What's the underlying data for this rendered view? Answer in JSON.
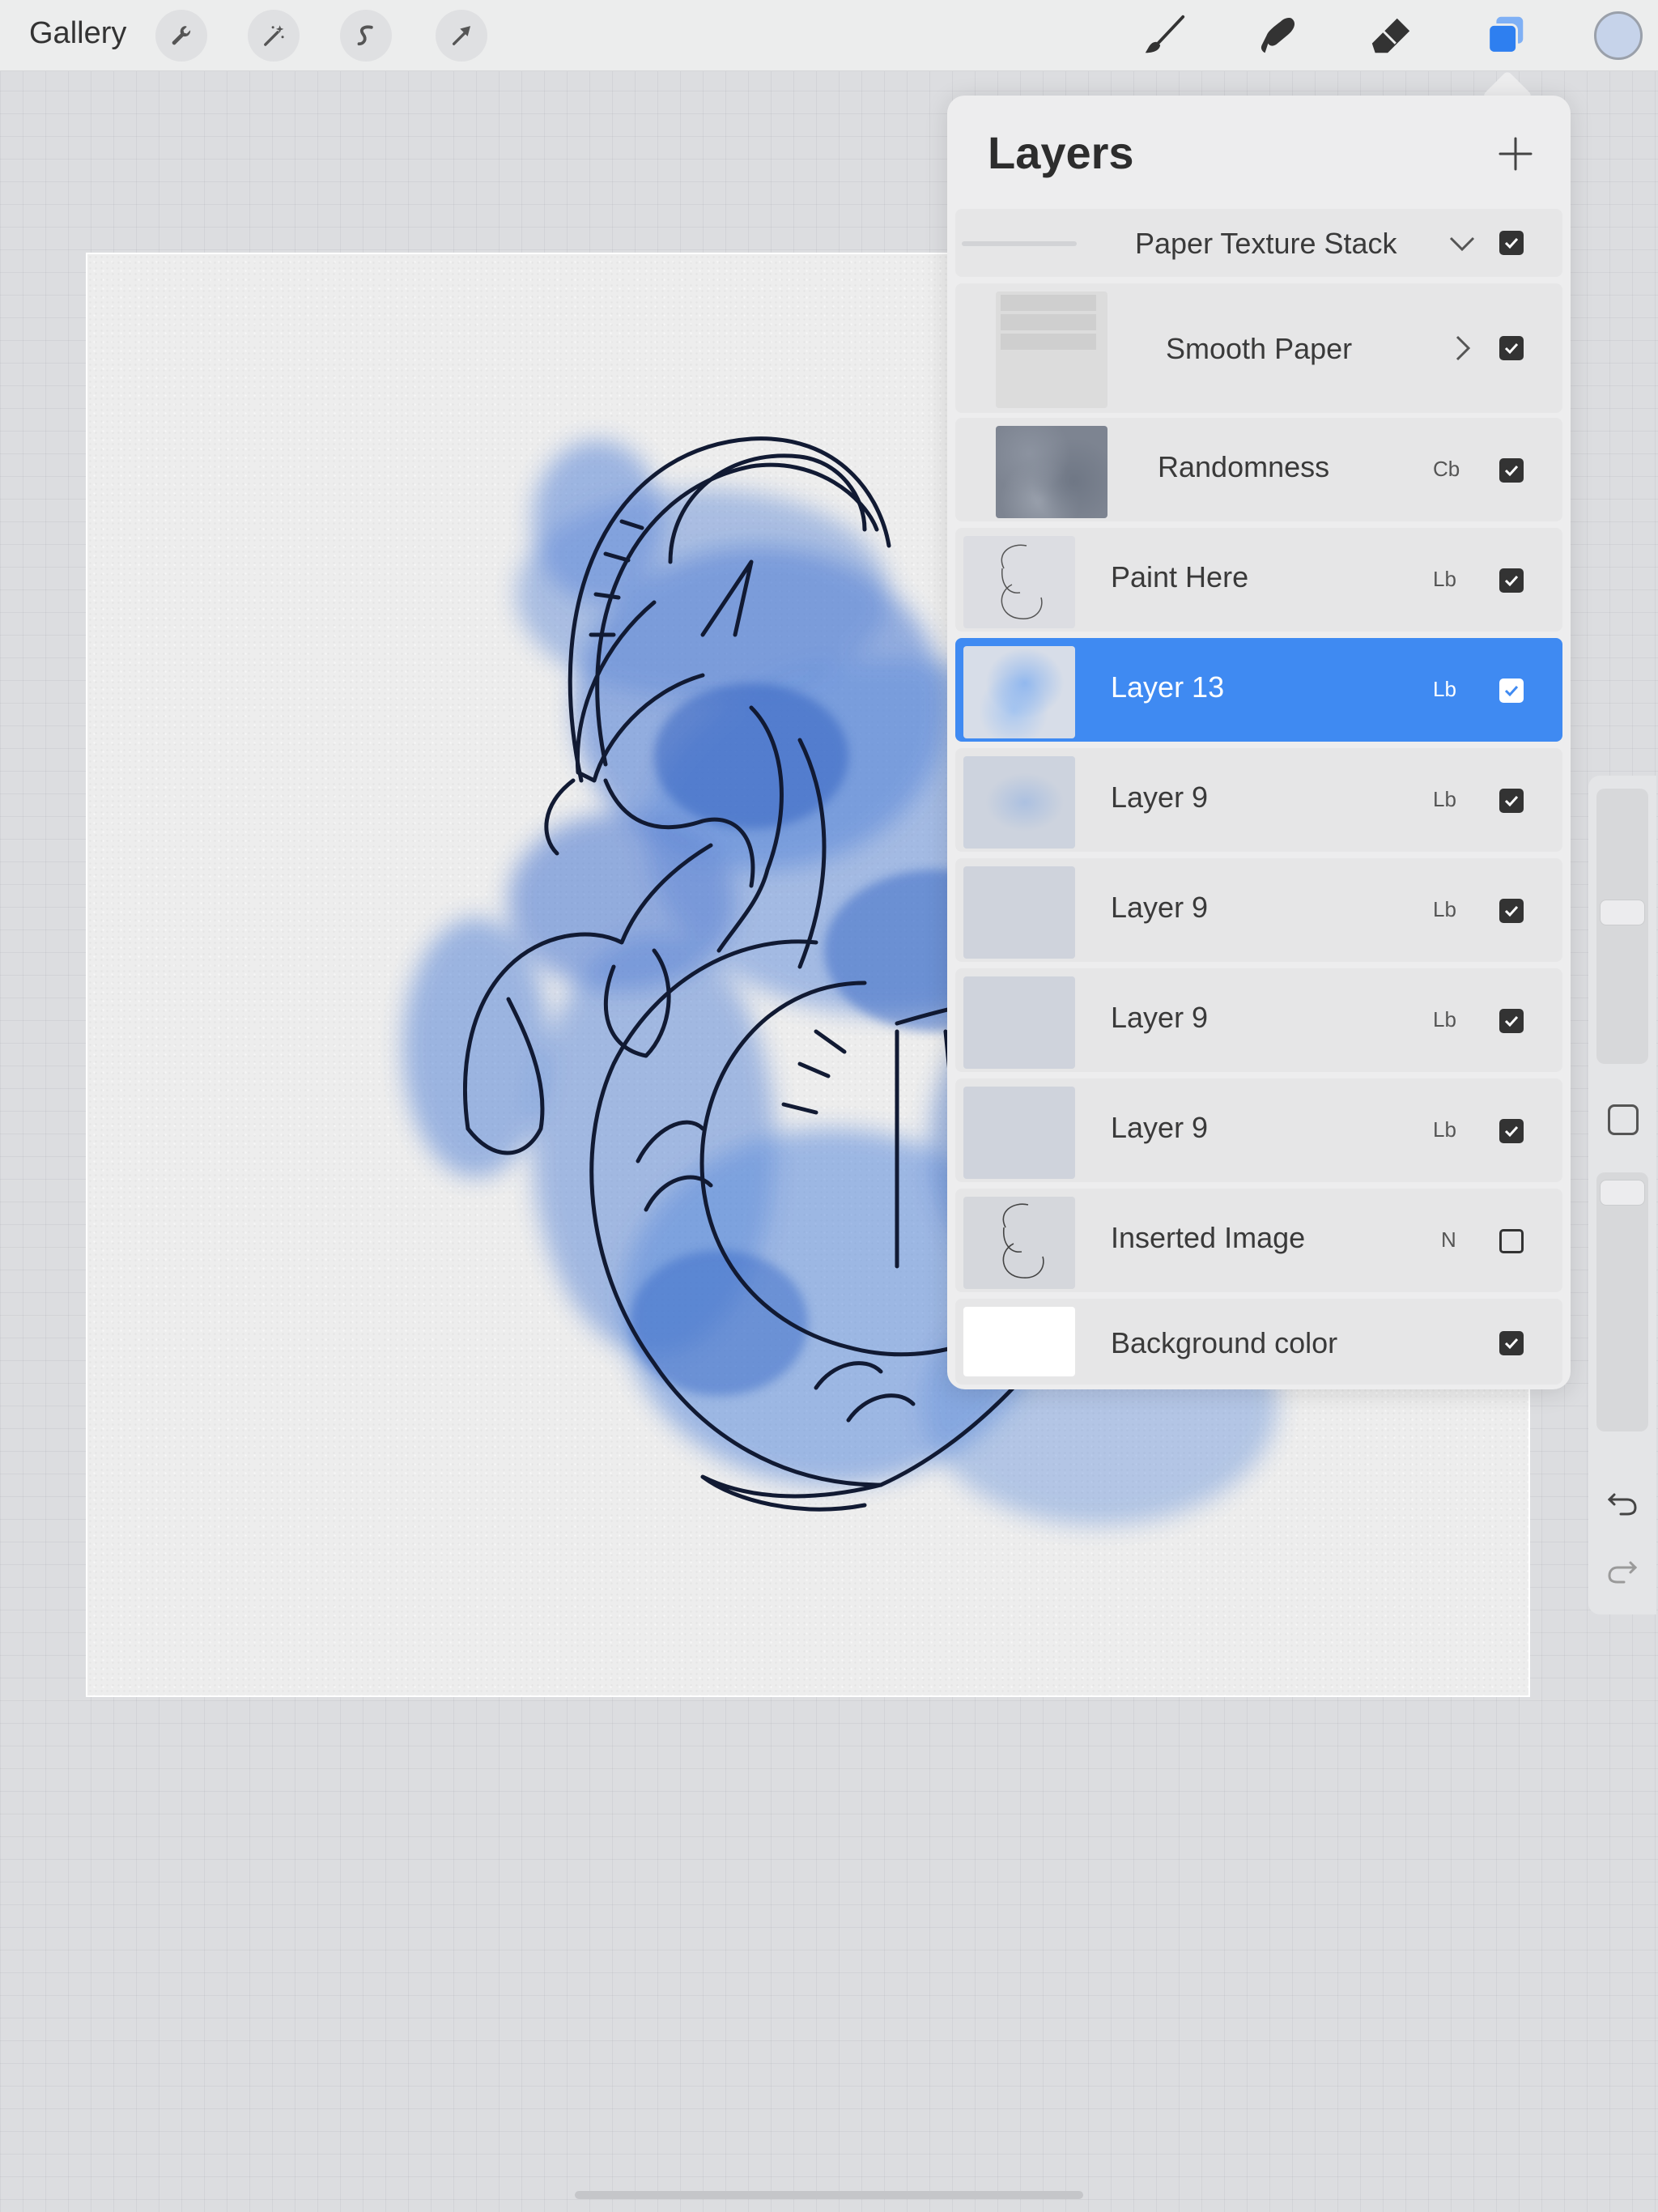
{
  "toolbar": {
    "gallery_label": "Gallery",
    "left_tools": [
      "wrench-icon",
      "magic-wand-icon",
      "selection-s-icon",
      "transform-arrow-icon"
    ],
    "right_tools": [
      "brush-icon",
      "smudge-icon",
      "eraser-icon",
      "layers-icon"
    ],
    "active_tool": "layers-icon",
    "current_color": "#c6d3ea",
    "accent_color": "#2e7ff0"
  },
  "layers_panel": {
    "title": "Layers",
    "rows": [
      {
        "name": "Paper Texture Stack",
        "blend": "",
        "visible": true,
        "kind": "group"
      },
      {
        "name": "Smooth Paper",
        "blend": "",
        "visible": true,
        "kind": "subgroup"
      },
      {
        "name": "Randomness",
        "blend": "Cb",
        "visible": true,
        "kind": "sublayer"
      },
      {
        "name": "Paint Here",
        "blend": "Lb",
        "visible": true,
        "kind": "layer"
      },
      {
        "name": "Layer 13",
        "blend": "Lb",
        "visible": true,
        "kind": "layer",
        "selected": true
      },
      {
        "name": "Layer 9",
        "blend": "Lb",
        "visible": true,
        "kind": "layer"
      },
      {
        "name": "Layer 9",
        "blend": "Lb",
        "visible": true,
        "kind": "layer"
      },
      {
        "name": "Layer 9",
        "blend": "Lb",
        "visible": true,
        "kind": "layer"
      },
      {
        "name": "Layer 9",
        "blend": "Lb",
        "visible": true,
        "kind": "layer"
      },
      {
        "name": "Inserted Image",
        "blend": "N",
        "visible": false,
        "kind": "layer"
      },
      {
        "name": "Background color",
        "blend": "",
        "visible": true,
        "kind": "background"
      }
    ],
    "selected_color": "#3f8af2"
  },
  "sidebar": {
    "brush_size_level": 0.55,
    "opacity_level": 0.97
  }
}
